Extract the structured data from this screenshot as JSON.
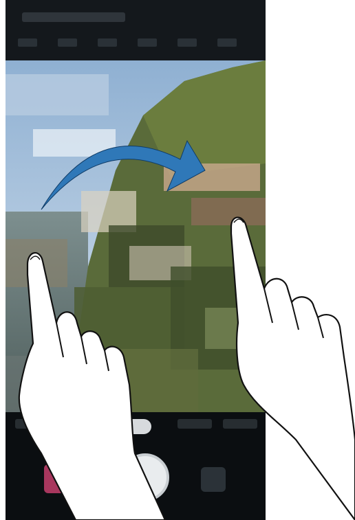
{
  "screen": {
    "description_hidden": false
  },
  "colors": {
    "sky": "#9fb9d6",
    "sky_light": "#c9d8e8",
    "cliff": "#5b6b3e",
    "arrow": "#2f78b8",
    "hand_fill": "#ffffff",
    "hand_stroke": "#111111",
    "accent_pink": "#a8375e"
  },
  "gesture": {
    "type": "swipe-right",
    "fingers": "two-hands"
  },
  "icons": {
    "gallery": "gallery-thumbnail-icon",
    "shutter": "shutter-icon",
    "switch": "switch-camera-icon",
    "arrow": "swipe-arrow-icon"
  }
}
